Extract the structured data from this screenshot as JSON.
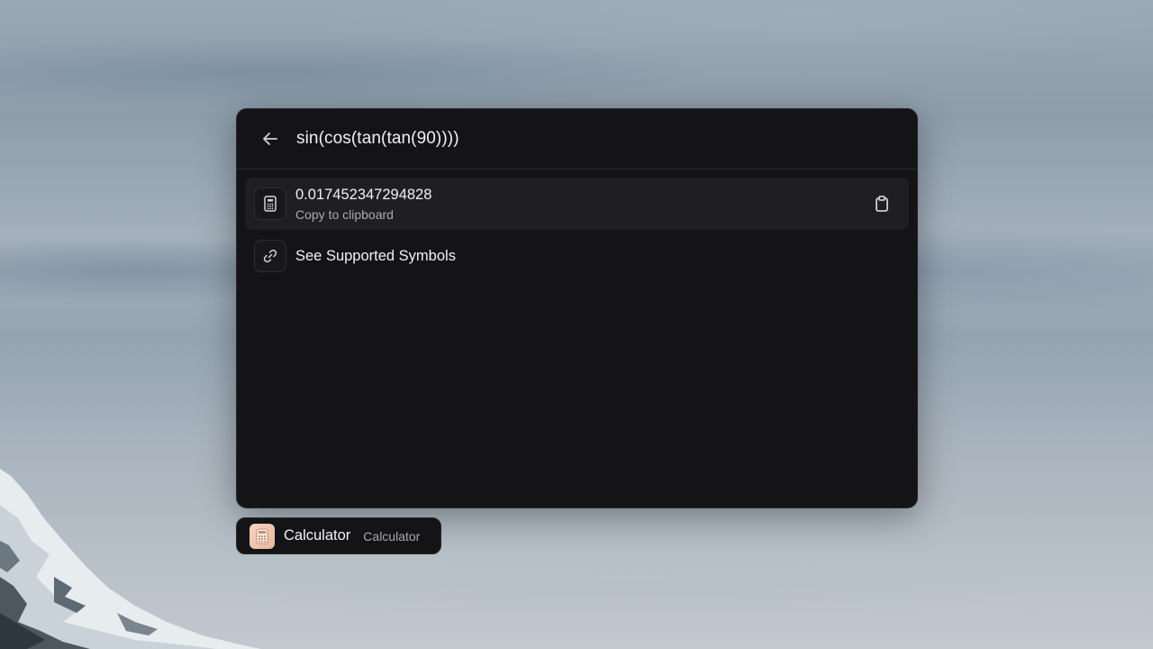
{
  "search": {
    "query": "sin(cos(tan(tan(90))))"
  },
  "results": [
    {
      "title": "0.017452347294828",
      "subtitle": "Copy to clipboard",
      "icon": "calculator-icon",
      "action_icon": "clipboard-icon",
      "selected": true
    },
    {
      "title": "See Supported Symbols",
      "icon": "link-icon",
      "selected": false
    }
  ],
  "footer": {
    "icon": "calculator-app-icon",
    "title": "Calculator",
    "subtitle": "Calculator"
  },
  "colors": {
    "panel_bg": "#141416",
    "selected_bg": "#1f1f22",
    "text_primary": "#f2f2f4",
    "text_secondary": "#a9a9ae",
    "app_icon_accent": "#e9b79c"
  }
}
